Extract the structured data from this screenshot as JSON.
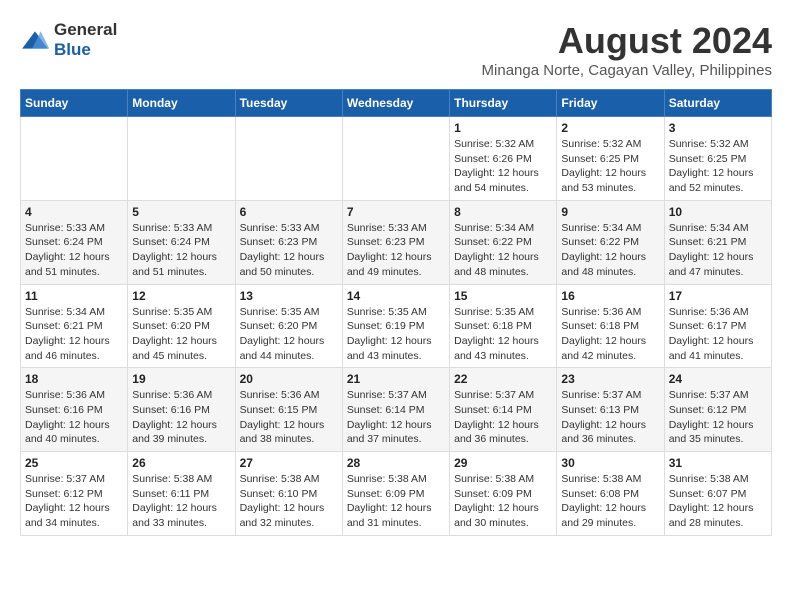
{
  "header": {
    "logo_general": "General",
    "logo_blue": "Blue",
    "month_title": "August 2024",
    "subtitle": "Minanga Norte, Cagayan Valley, Philippines"
  },
  "days_of_week": [
    "Sunday",
    "Monday",
    "Tuesday",
    "Wednesday",
    "Thursday",
    "Friday",
    "Saturday"
  ],
  "weeks": [
    {
      "alt": false,
      "days": [
        {
          "num": "",
          "info": ""
        },
        {
          "num": "",
          "info": ""
        },
        {
          "num": "",
          "info": ""
        },
        {
          "num": "",
          "info": ""
        },
        {
          "num": "1",
          "info": "Sunrise: 5:32 AM\nSunset: 6:26 PM\nDaylight: 12 hours\nand 54 minutes."
        },
        {
          "num": "2",
          "info": "Sunrise: 5:32 AM\nSunset: 6:25 PM\nDaylight: 12 hours\nand 53 minutes."
        },
        {
          "num": "3",
          "info": "Sunrise: 5:32 AM\nSunset: 6:25 PM\nDaylight: 12 hours\nand 52 minutes."
        }
      ]
    },
    {
      "alt": true,
      "days": [
        {
          "num": "4",
          "info": "Sunrise: 5:33 AM\nSunset: 6:24 PM\nDaylight: 12 hours\nand 51 minutes."
        },
        {
          "num": "5",
          "info": "Sunrise: 5:33 AM\nSunset: 6:24 PM\nDaylight: 12 hours\nand 51 minutes."
        },
        {
          "num": "6",
          "info": "Sunrise: 5:33 AM\nSunset: 6:23 PM\nDaylight: 12 hours\nand 50 minutes."
        },
        {
          "num": "7",
          "info": "Sunrise: 5:33 AM\nSunset: 6:23 PM\nDaylight: 12 hours\nand 49 minutes."
        },
        {
          "num": "8",
          "info": "Sunrise: 5:34 AM\nSunset: 6:22 PM\nDaylight: 12 hours\nand 48 minutes."
        },
        {
          "num": "9",
          "info": "Sunrise: 5:34 AM\nSunset: 6:22 PM\nDaylight: 12 hours\nand 48 minutes."
        },
        {
          "num": "10",
          "info": "Sunrise: 5:34 AM\nSunset: 6:21 PM\nDaylight: 12 hours\nand 47 minutes."
        }
      ]
    },
    {
      "alt": false,
      "days": [
        {
          "num": "11",
          "info": "Sunrise: 5:34 AM\nSunset: 6:21 PM\nDaylight: 12 hours\nand 46 minutes."
        },
        {
          "num": "12",
          "info": "Sunrise: 5:35 AM\nSunset: 6:20 PM\nDaylight: 12 hours\nand 45 minutes."
        },
        {
          "num": "13",
          "info": "Sunrise: 5:35 AM\nSunset: 6:20 PM\nDaylight: 12 hours\nand 44 minutes."
        },
        {
          "num": "14",
          "info": "Sunrise: 5:35 AM\nSunset: 6:19 PM\nDaylight: 12 hours\nand 43 minutes."
        },
        {
          "num": "15",
          "info": "Sunrise: 5:35 AM\nSunset: 6:18 PM\nDaylight: 12 hours\nand 43 minutes."
        },
        {
          "num": "16",
          "info": "Sunrise: 5:36 AM\nSunset: 6:18 PM\nDaylight: 12 hours\nand 42 minutes."
        },
        {
          "num": "17",
          "info": "Sunrise: 5:36 AM\nSunset: 6:17 PM\nDaylight: 12 hours\nand 41 minutes."
        }
      ]
    },
    {
      "alt": true,
      "days": [
        {
          "num": "18",
          "info": "Sunrise: 5:36 AM\nSunset: 6:16 PM\nDaylight: 12 hours\nand 40 minutes."
        },
        {
          "num": "19",
          "info": "Sunrise: 5:36 AM\nSunset: 6:16 PM\nDaylight: 12 hours\nand 39 minutes."
        },
        {
          "num": "20",
          "info": "Sunrise: 5:36 AM\nSunset: 6:15 PM\nDaylight: 12 hours\nand 38 minutes."
        },
        {
          "num": "21",
          "info": "Sunrise: 5:37 AM\nSunset: 6:14 PM\nDaylight: 12 hours\nand 37 minutes."
        },
        {
          "num": "22",
          "info": "Sunrise: 5:37 AM\nSunset: 6:14 PM\nDaylight: 12 hours\nand 36 minutes."
        },
        {
          "num": "23",
          "info": "Sunrise: 5:37 AM\nSunset: 6:13 PM\nDaylight: 12 hours\nand 36 minutes."
        },
        {
          "num": "24",
          "info": "Sunrise: 5:37 AM\nSunset: 6:12 PM\nDaylight: 12 hours\nand 35 minutes."
        }
      ]
    },
    {
      "alt": false,
      "days": [
        {
          "num": "25",
          "info": "Sunrise: 5:37 AM\nSunset: 6:12 PM\nDaylight: 12 hours\nand 34 minutes."
        },
        {
          "num": "26",
          "info": "Sunrise: 5:38 AM\nSunset: 6:11 PM\nDaylight: 12 hours\nand 33 minutes."
        },
        {
          "num": "27",
          "info": "Sunrise: 5:38 AM\nSunset: 6:10 PM\nDaylight: 12 hours\nand 32 minutes."
        },
        {
          "num": "28",
          "info": "Sunrise: 5:38 AM\nSunset: 6:09 PM\nDaylight: 12 hours\nand 31 minutes."
        },
        {
          "num": "29",
          "info": "Sunrise: 5:38 AM\nSunset: 6:09 PM\nDaylight: 12 hours\nand 30 minutes."
        },
        {
          "num": "30",
          "info": "Sunrise: 5:38 AM\nSunset: 6:08 PM\nDaylight: 12 hours\nand 29 minutes."
        },
        {
          "num": "31",
          "info": "Sunrise: 5:38 AM\nSunset: 6:07 PM\nDaylight: 12 hours\nand 28 minutes."
        }
      ]
    }
  ]
}
